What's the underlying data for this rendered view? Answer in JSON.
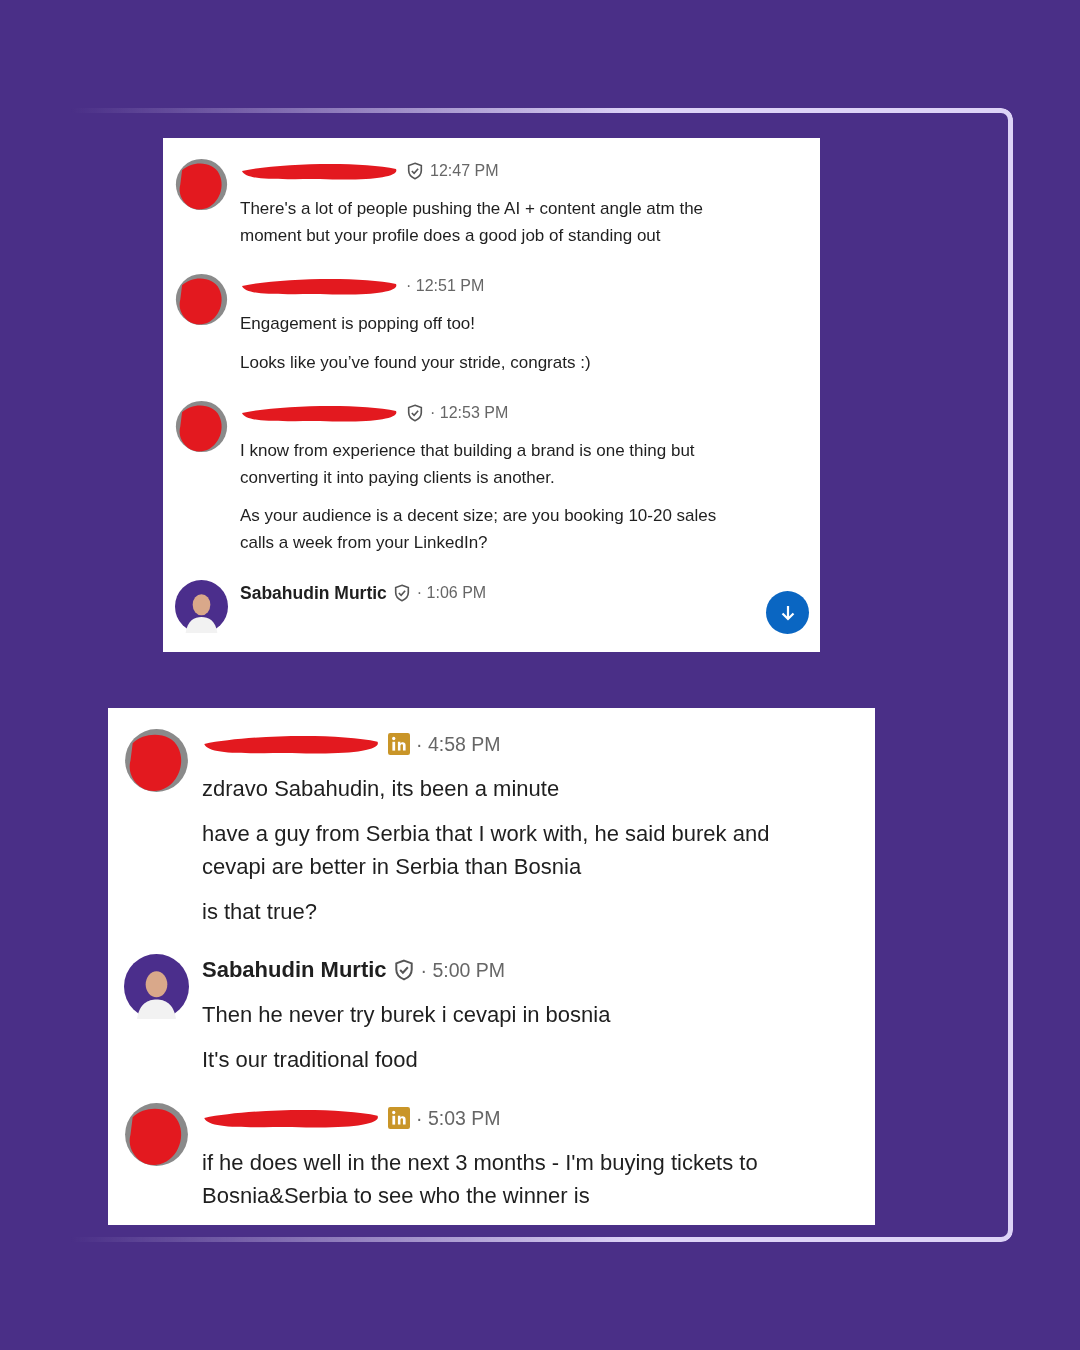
{
  "panels": [
    {
      "scroll_button": true,
      "messages": [
        {
          "avatar_redacted": true,
          "name_redacted": true,
          "verified": true,
          "linkedin_badge": false,
          "time": "12:47 PM",
          "paragraphs": [
            "There's a lot of people pushing the AI + content angle atm the moment but your profile does a good job of standing out"
          ]
        },
        {
          "avatar_redacted": true,
          "name_redacted": true,
          "verified": false,
          "linkedin_badge": false,
          "time": "· 12:51 PM",
          "paragraphs": [
            "Engagement is popping off too!",
            "Looks like you’ve found your stride, congrats :)"
          ]
        },
        {
          "avatar_redacted": true,
          "name_redacted": true,
          "verified": true,
          "linkedin_badge": false,
          "time": "· 12:53 PM",
          "paragraphs": [
            "I know from experience that building a brand is one thing but converting it into paying clients is another.",
            "As your audience is a decent size; are you booking 10-20 sales calls a week from your LinkedIn?"
          ]
        },
        {
          "avatar_redacted": false,
          "name_redacted": false,
          "name": "Sabahudin Murtic",
          "verified": true,
          "linkedin_badge": false,
          "time": "· 1:06 PM"
        }
      ]
    },
    {
      "scroll_button": false,
      "messages": [
        {
          "avatar_redacted": true,
          "name_redacted": true,
          "verified": false,
          "linkedin_badge": true,
          "time": "· 4:58 PM",
          "paragraphs": [
            "zdravo Sabahudin, its been a minute",
            "have a guy from Serbia that I work with, he said burek and cevapi are better in Serbia than Bosnia",
            "is that true?"
          ]
        },
        {
          "avatar_redacted": false,
          "name_redacted": false,
          "name": "Sabahudin Murtic",
          "verified": true,
          "linkedin_badge": false,
          "time": "· 5:00 PM",
          "paragraphs": [
            "Then he never try burek i cevapi in bosnia",
            "It's our traditional food"
          ]
        },
        {
          "avatar_redacted": true,
          "name_redacted": true,
          "verified": false,
          "linkedin_badge": true,
          "time": "· 5:03 PM",
          "paragraphs": [
            "if he does well in the next 3 months - I'm buying tickets to Bosnia&Serbia to see who the winner is"
          ]
        }
      ]
    }
  ]
}
